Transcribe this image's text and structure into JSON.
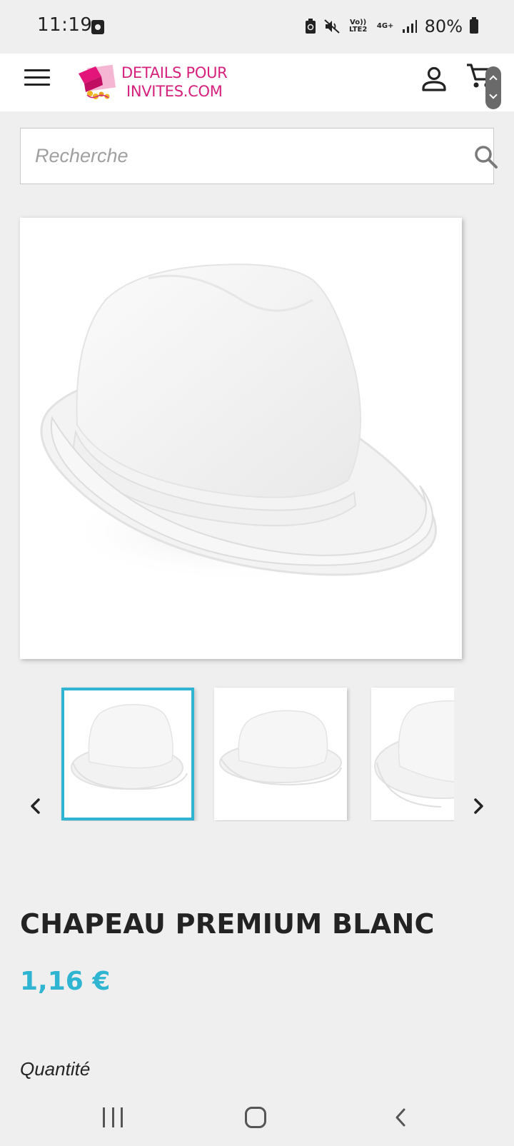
{
  "status_bar": {
    "time": "11:19",
    "volte_label": "Vo)) LTE2",
    "network_label": "4G+",
    "battery": "80%"
  },
  "header": {
    "logo_text_line1": "DETAILS POUR",
    "logo_text_line2": "INVITES.COM",
    "brand_color": "#d6207c",
    "menu_icon": "hamburger-menu-icon",
    "account_icon": "user-icon",
    "cart_icon": "cart-icon"
  },
  "search": {
    "placeholder": "Recherche",
    "value": "",
    "icon": "search-icon"
  },
  "gallery": {
    "thumbnails": [
      {
        "alt": "Chapeau premium blanc - vue 1",
        "selected": true
      },
      {
        "alt": "Chapeau premium blanc - vue 2",
        "selected": false
      },
      {
        "alt": "Chapeau premium blanc - vue 3",
        "selected": false
      }
    ],
    "selected_border_color": "#2fb5d2",
    "prev_icon": "chevron-left-icon",
    "next_icon": "chevron-right-icon"
  },
  "product": {
    "title": "CHAPEAU PREMIUM BLANC",
    "price": "1,16 €",
    "price_color": "#2fb5d2",
    "quantity_label": "Quantité"
  },
  "nav_bar": {
    "recent_icon": "recent-apps-icon",
    "home_icon": "home-icon",
    "back_icon": "back-icon"
  }
}
